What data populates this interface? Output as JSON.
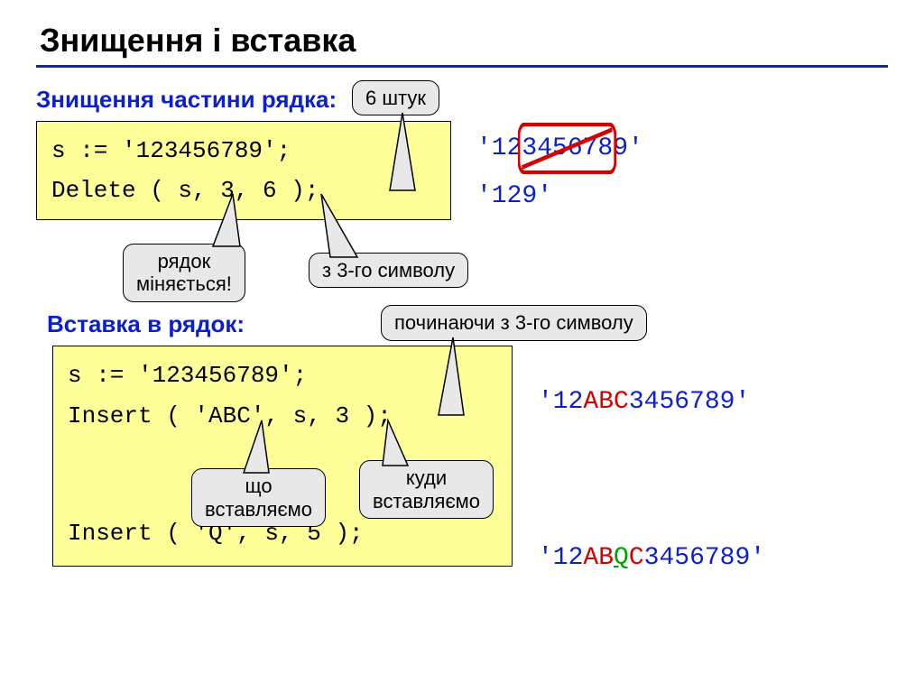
{
  "title": "Знищення і вставка",
  "section1": {
    "label": "Знищення частини рядка:",
    "code": {
      "line1": "s := '123456789';",
      "line2": "Delete ( s, 3, 6 );"
    },
    "results": {
      "r1_pre": "'12",
      "r1_mid": "345678",
      "r1_post": "9'",
      "r2": "'129'"
    },
    "callouts": {
      "top": "6 штук",
      "left_line1": "рядок",
      "left_line2": "міняється!",
      "right": "з 3-го символу"
    }
  },
  "section2": {
    "label": "Вставка в рядок:",
    "code": {
      "line1": "s := '123456789';",
      "line2": "Insert ( 'ABC', s, 3 );",
      "line3": "Insert ( 'Q', s, 5 );"
    },
    "results": {
      "r1_pre": "'12",
      "r1_ins": "ABC",
      "r1_post": "3456789'",
      "r2_pre": "'12",
      "r2_a": "AB",
      "r2_q": "Q",
      "r2_c": "C",
      "r2_post": "3456789'"
    },
    "callouts": {
      "top": "починаючи з 3-го символу",
      "left_line1": "що",
      "left_line2": "вставляємо",
      "right_line1": "куди",
      "right_line2": "вставляємо"
    }
  }
}
